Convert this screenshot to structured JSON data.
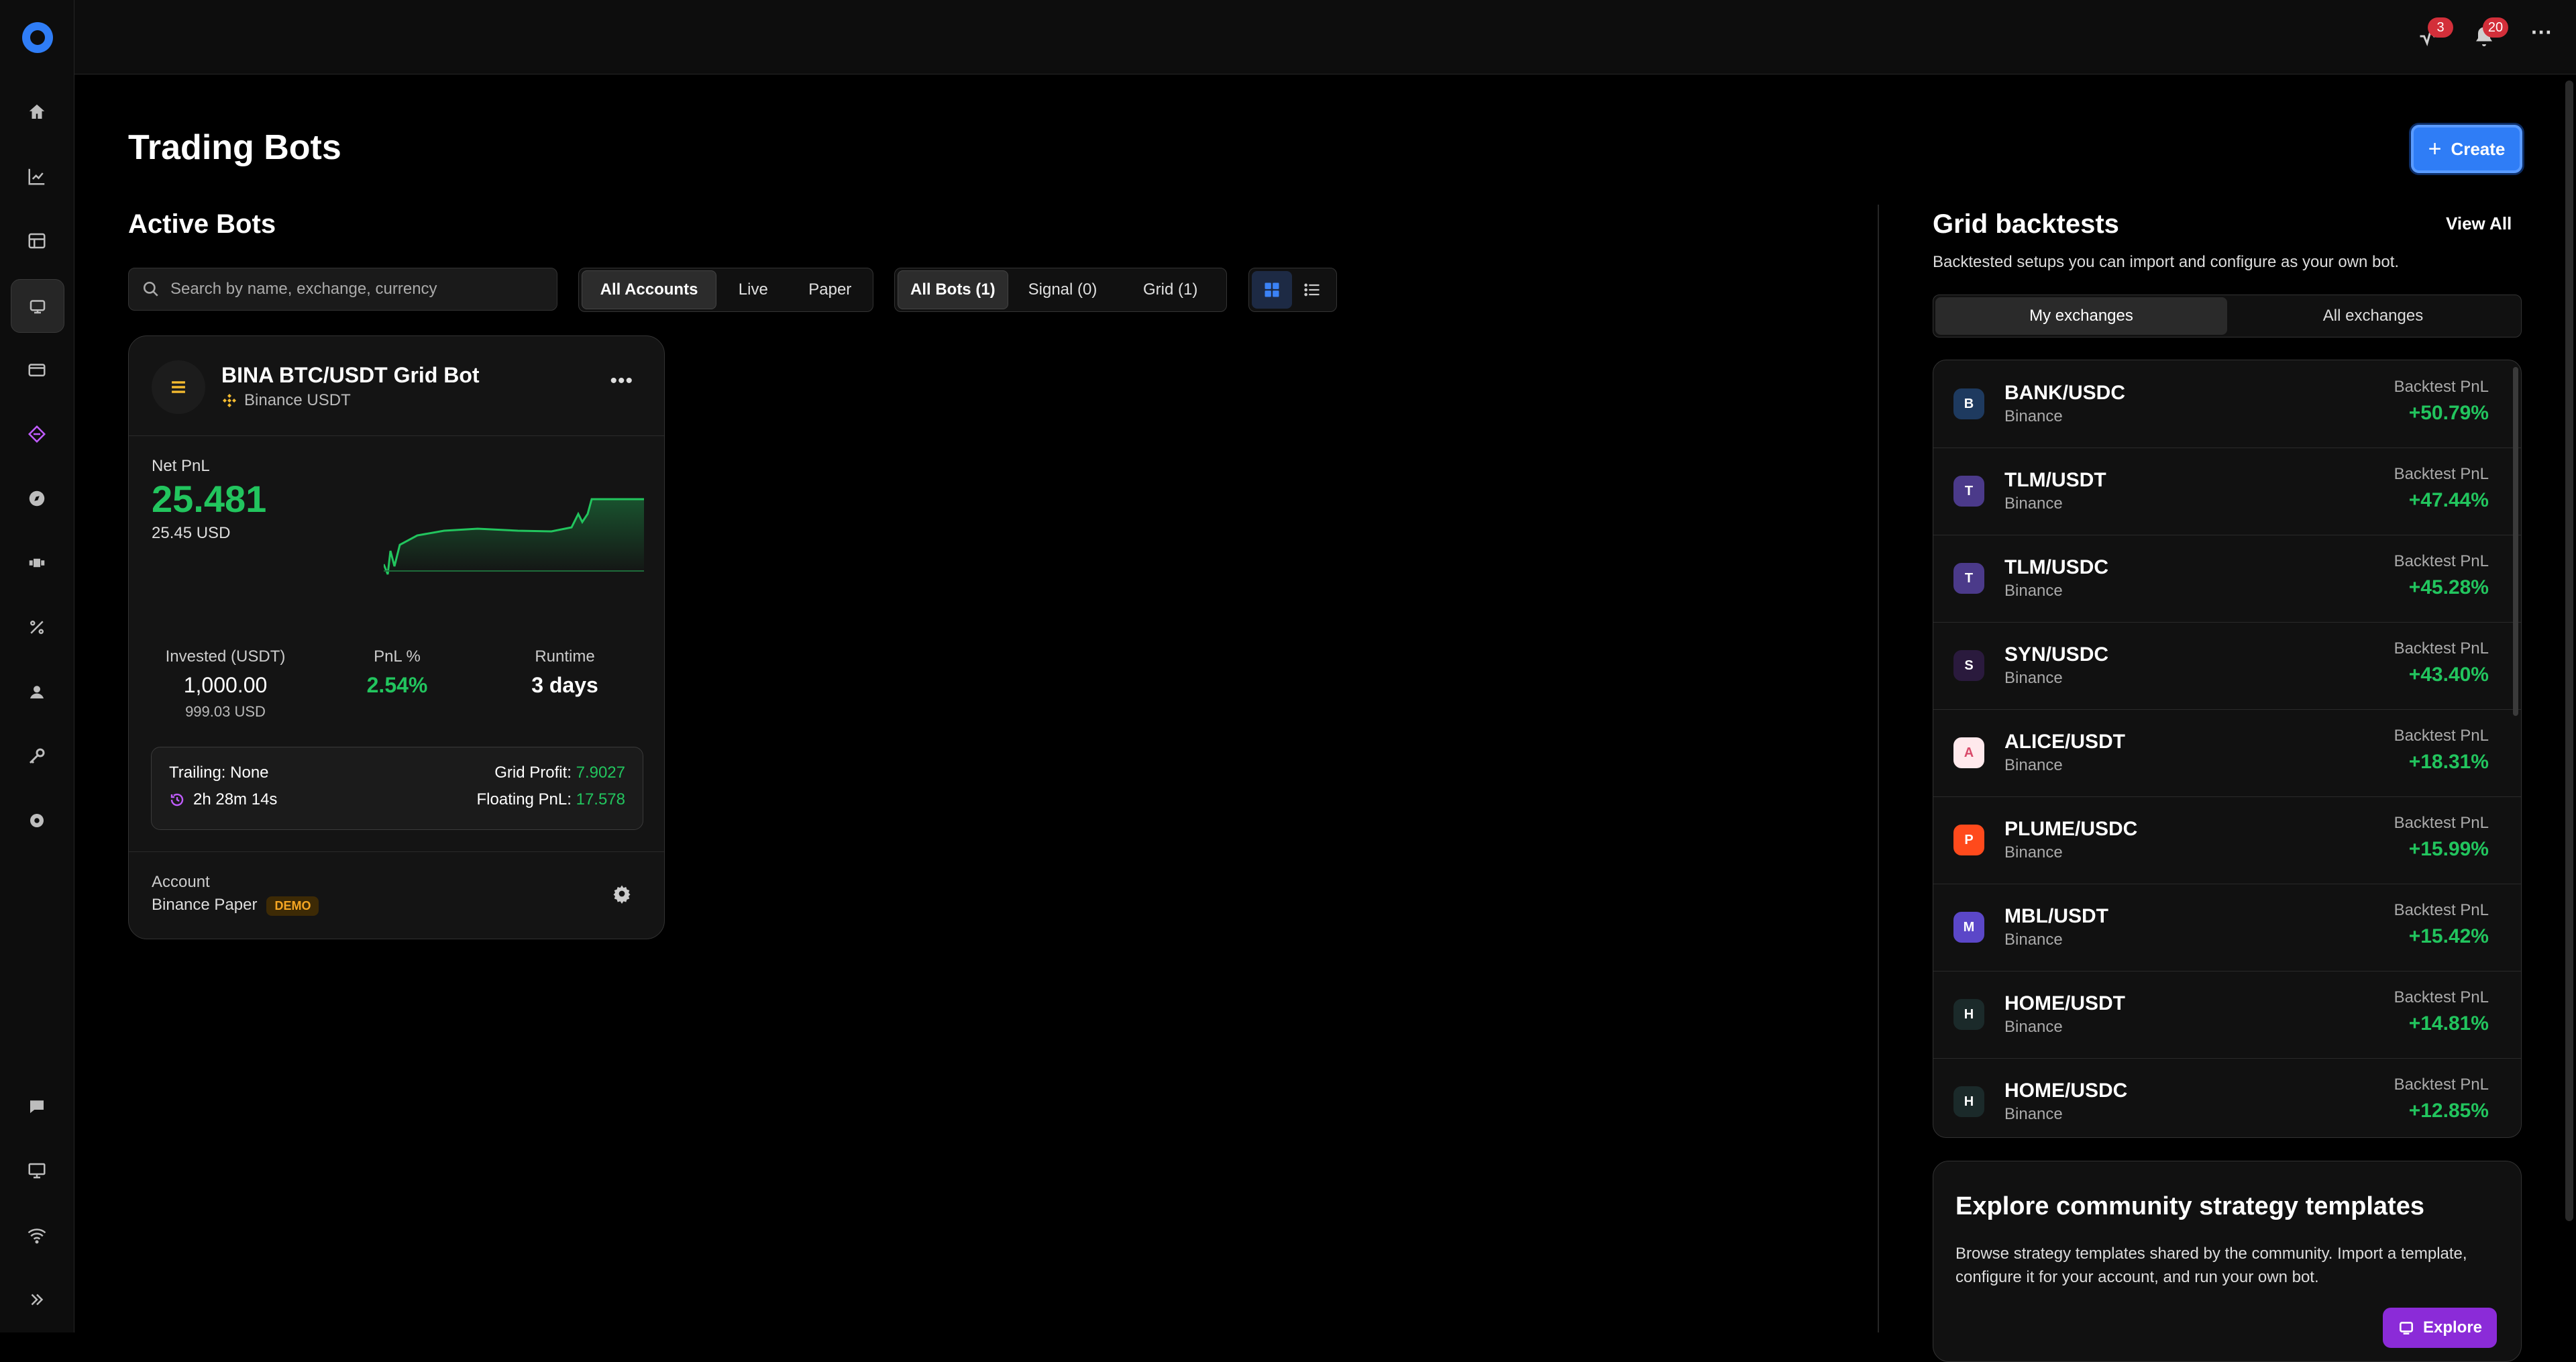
{
  "page": {
    "title": "Trading Bots",
    "create_label": "Create"
  },
  "topbar": {
    "badge_activity": "3",
    "badge_notifications": "20",
    "more": "···"
  },
  "sidebar": {
    "items": [
      "home-icon",
      "chart-icon",
      "grid-icon",
      "bot-icon",
      "wallet-icon",
      "diamond-icon",
      "compass-icon",
      "puzzle-icon",
      "percent-icon",
      "agent-icon",
      "key-icon",
      "gear-icon",
      "chat-icon",
      "monitor-icon",
      "wifi-icon",
      "expand-icon"
    ]
  },
  "active_bots": {
    "title": "Active Bots",
    "search_placeholder": "Search by name, exchange, currency",
    "account_filters": [
      "All Accounts",
      "Live",
      "Paper"
    ],
    "bot_filters": [
      "All Bots (1)",
      "Signal (0)",
      "Grid (1)"
    ]
  },
  "bot": {
    "name": "BINA BTC/USDT Grid Bot",
    "exchange": "Binance USDT",
    "net_pnl_label": "Net PnL",
    "net_pnl": "25.481",
    "net_pnl_usd": "25.45 USD",
    "invested_label": "Invested (USDT)",
    "invested": "1,000.00",
    "invested_usd": "999.03 USD",
    "pnl_pct_label": "PnL %",
    "pnl_pct": "2.54%",
    "runtime_label": "Runtime",
    "runtime": "3 days",
    "trailing": "Trailing: None",
    "elapsed": "2h 28m 14s",
    "grid_profit_label": "Grid Profit:",
    "grid_profit": "7.9027",
    "floating_pnl_label": "Floating PnL:",
    "floating_pnl": "17.578",
    "account_label": "Account",
    "account": "Binance Paper",
    "demo": "DEMO",
    "accent": "#22c55e"
  },
  "backtests": {
    "title": "Grid backtests",
    "view_all": "View All",
    "subtitle": "Backtested setups you can import and configure as your own bot.",
    "tabs": [
      "My exchanges",
      "All exchanges"
    ],
    "pnl_label": "Backtest PnL",
    "rows": [
      {
        "pair": "BANK/USDC",
        "exchange": "Binance",
        "pnl": "+50.79%",
        "icon_color": "#1e3a5f",
        "glyph": "B"
      },
      {
        "pair": "TLM/USDT",
        "exchange": "Binance",
        "pnl": "+47.44%",
        "icon_color": "#4b3a8a",
        "glyph": "T"
      },
      {
        "pair": "TLM/USDC",
        "exchange": "Binance",
        "pnl": "+45.28%",
        "icon_color": "#4b3a8a",
        "glyph": "T"
      },
      {
        "pair": "SYN/USDC",
        "exchange": "Binance",
        "pnl": "+43.40%",
        "icon_color": "#2a1a3d",
        "glyph": "S"
      },
      {
        "pair": "ALICE/USDT",
        "exchange": "Binance",
        "pnl": "+18.31%",
        "icon_color": "#ffe9ec",
        "glyph": "A"
      },
      {
        "pair": "PLUME/USDC",
        "exchange": "Binance",
        "pnl": "+15.99%",
        "icon_color": "#ff4a1c",
        "glyph": "P"
      },
      {
        "pair": "MBL/USDT",
        "exchange": "Binance",
        "pnl": "+15.42%",
        "icon_color": "#5b47c8",
        "glyph": "M"
      },
      {
        "pair": "HOME/USDT",
        "exchange": "Binance",
        "pnl": "+14.81%",
        "icon_color": "#1b2a2a",
        "glyph": "H"
      },
      {
        "pair": "HOME/USDC",
        "exchange": "Binance",
        "pnl": "+12.85%",
        "icon_color": "#1b2a2a",
        "glyph": "H"
      }
    ]
  },
  "explore": {
    "title": "Explore community strategy templates",
    "text": "Browse strategy templates shared by the community. Import a template, configure it for your account, and run your own bot.",
    "button": "Explore"
  }
}
